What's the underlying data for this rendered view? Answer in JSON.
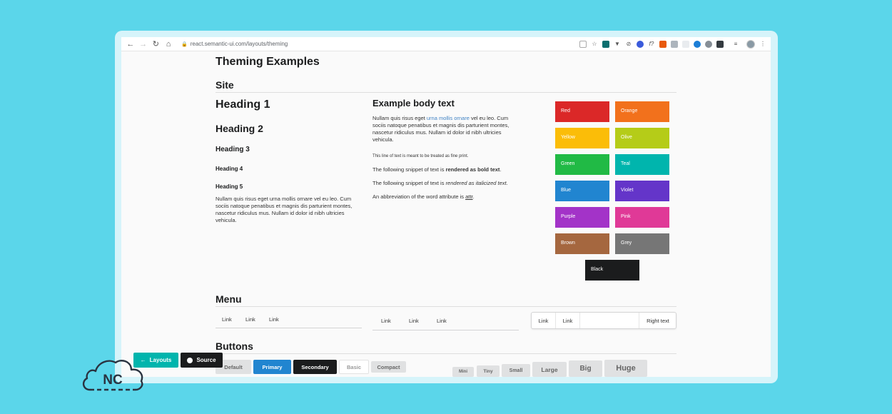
{
  "browser": {
    "url": "react.semantic-ui.com/layouts/theming",
    "nav_icons": [
      "back-icon",
      "forward-icon",
      "reload-icon",
      "home-icon"
    ]
  },
  "page": {
    "title": "Theming Examples",
    "site_section": "Site",
    "menu_section": "Menu",
    "buttons_section": "Buttons"
  },
  "headings": {
    "h1": "Heading 1",
    "h2": "Heading 2",
    "h3": "Heading 3",
    "h4": "Heading 4",
    "h5": "Heading 5",
    "paragraph": "Nullam quis risus eget urna mollis ornare vel eu leo. Cum sociis natoque penatibus et magnis dis parturient montes, nascetur ridiculus mus. Nullam id dolor id nibh ultricies vehicula."
  },
  "body_text": {
    "title": "Example body text",
    "p1_before": "Nullam quis risus eget ",
    "p1_link": "urna mollis ornare",
    "p1_after": " vel eu leo. Cum sociis natoque penatibus et magnis dis parturient montes, nascetur ridiculus mus. Nullam id dolor id nibh ultricies vehicula.",
    "fine_print": "This line of text is meant to be treated as fine print.",
    "bold_before": "The following snippet of text is ",
    "bold_text": "rendered as bold text",
    "italic_before": "The following snippet of text is ",
    "italic_text": "rendered as italicized text",
    "abbr_before": "An abbreviation of the word attribute is ",
    "abbr_text": "attr",
    "period": "."
  },
  "colors": [
    {
      "label": "Red",
      "hex": "#db2828"
    },
    {
      "label": "Orange",
      "hex": "#f2711c"
    },
    {
      "label": "Yellow",
      "hex": "#fbbd08"
    },
    {
      "label": "Olive",
      "hex": "#b5cc18"
    },
    {
      "label": "Green",
      "hex": "#21ba45"
    },
    {
      "label": "Teal",
      "hex": "#00b5ad"
    },
    {
      "label": "Blue",
      "hex": "#2185d0"
    },
    {
      "label": "Violet",
      "hex": "#6435c9"
    },
    {
      "label": "Purple",
      "hex": "#a333c8"
    },
    {
      "label": "Pink",
      "hex": "#e03997"
    },
    {
      "label": "Brown",
      "hex": "#a5673f"
    },
    {
      "label": "Grey",
      "hex": "#767676"
    },
    {
      "label": "Black",
      "hex": "#1b1c1d"
    }
  ],
  "menus": {
    "menu1": [
      "Link",
      "Link",
      "Link"
    ],
    "menu2": [
      "Link",
      "Link",
      "Link"
    ],
    "menu3": [
      "Link",
      "Link"
    ],
    "menu3_right": "Right text"
  },
  "buttons": {
    "emphasis": [
      "Default",
      "Primary",
      "Secondary",
      "Basic",
      "Compact"
    ],
    "sizes": [
      "Mini",
      "Tiny",
      "Small",
      "Large",
      "Big",
      "Huge"
    ]
  },
  "floating": {
    "layouts": "Layouts",
    "source": "Source",
    "layouts_color": "#00b5ad",
    "source_color": "#1b1c1d"
  },
  "logo": {
    "text": "NC"
  }
}
